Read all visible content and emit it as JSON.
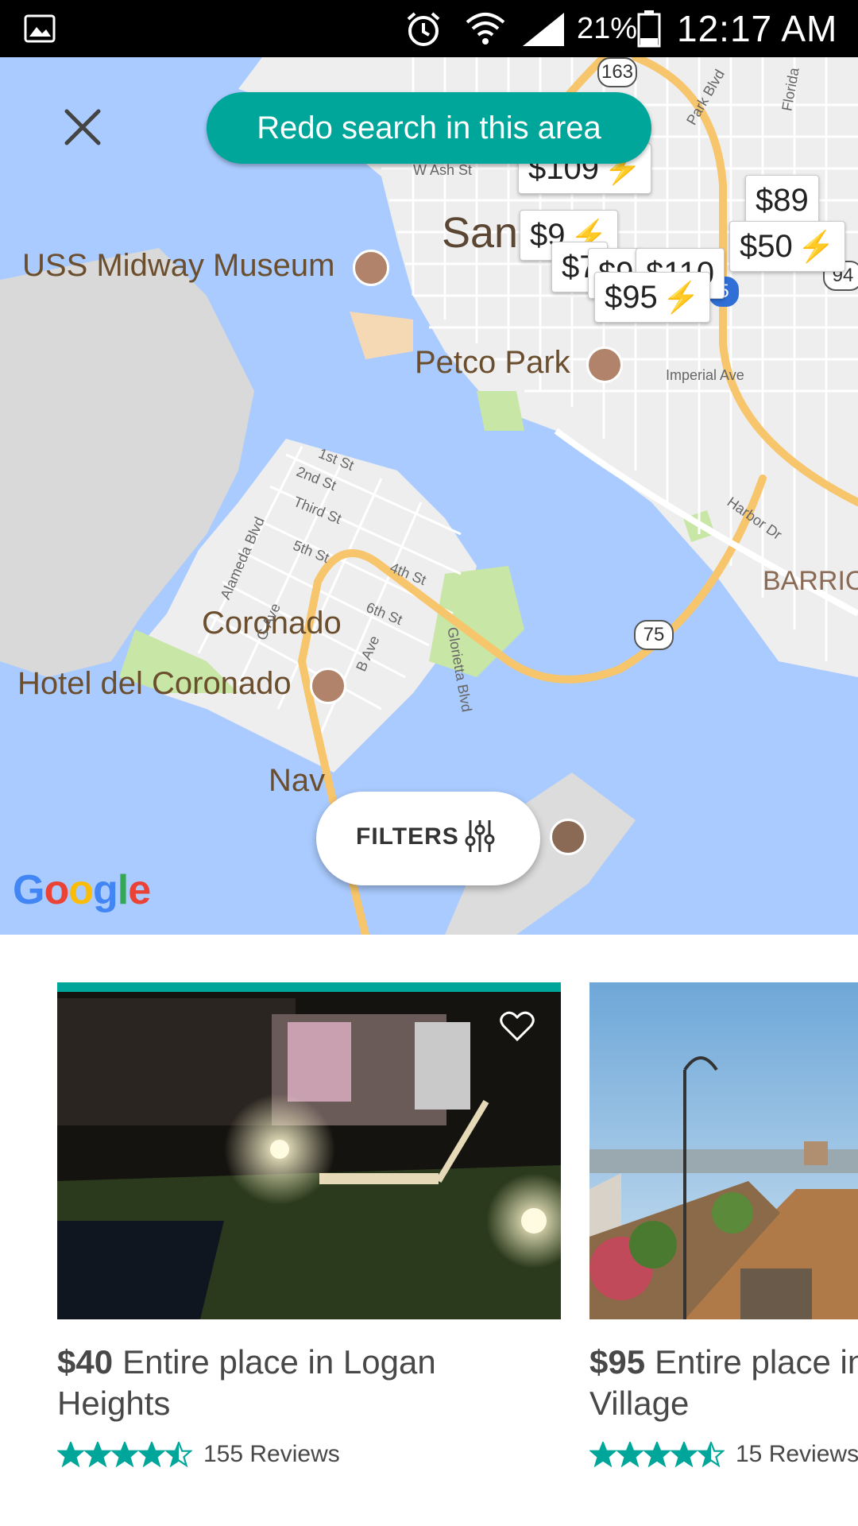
{
  "status_bar": {
    "battery_percent": "21%",
    "time": "12:17 AM",
    "icons": [
      "gallery-icon",
      "alarm-icon",
      "wifi-icon",
      "signal-icon",
      "battery-icon"
    ]
  },
  "map": {
    "redo_search_label": "Redo search in this area",
    "filters_label": "FILTERS",
    "google_logo": "Google",
    "place_labels": {
      "san_diego": "San",
      "uss_midway": "USS Midway Museum",
      "petco": "Petco Park",
      "coronado": "Coronado",
      "hotel_del": "Hotel del Coronado",
      "naval": "Nav",
      "barrio": "BARRIO"
    },
    "street_labels": {
      "w_ash": "W Ash St",
      "imperial": "Imperial Ave",
      "harbor": "Harbor Dr",
      "st1": "1st St",
      "st2": "2nd St",
      "st3": "Third St",
      "st5": "5th St",
      "st4": "4th St",
      "st6": "6th St",
      "alameda": "Alameda Blvd",
      "g_ave": "G Ave",
      "b_ave": "B Ave",
      "glorietta": "Glorietta Blvd",
      "park_blvd": "Park Blvd",
      "florida": "Florida"
    },
    "highway_shields": {
      "h163": "163",
      "h75": "75",
      "h5": "5",
      "h94": "94"
    },
    "price_pins": [
      {
        "id": "p109",
        "label": "$109",
        "instant": true
      },
      {
        "id": "p89",
        "label": "$89",
        "instant": false
      },
      {
        "id": "p50",
        "label": "$50",
        "instant": true
      },
      {
        "id": "p94",
        "label": "$9",
        "instant": true
      },
      {
        "id": "p7x",
        "label": "$7",
        "instant": false
      },
      {
        "id": "p9x",
        "label": "$9",
        "instant": false
      },
      {
        "id": "p110",
        "label": "$110",
        "instant": false
      },
      {
        "id": "p95",
        "label": "$95",
        "instant": true
      }
    ]
  },
  "listings": [
    {
      "price": "$40",
      "description": "Entire place in Logan Heights",
      "rating": 4.5,
      "reviews": "155 Reviews",
      "selected": true
    },
    {
      "price": "$95",
      "description": "Entire place in Little Italy Village",
      "rating": 4.5,
      "reviews": "15 Reviews",
      "selected": false
    }
  ],
  "colors": {
    "accent": "#00a699",
    "star": "#00a699",
    "water": "#aacbff",
    "land": "#eeeeee",
    "park": "#c8e6a5",
    "highway": "#f7c56b",
    "instant_bolt": "#f5c400"
  }
}
